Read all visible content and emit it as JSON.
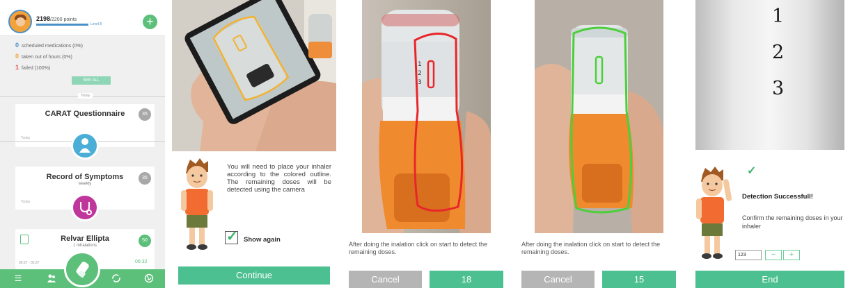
{
  "dashboard": {
    "points": "2198",
    "points_total": "/2200 points",
    "level": "Level 8",
    "progress": 0.9991,
    "legend": [
      {
        "number": "0",
        "text": "scheduled medications (0%)",
        "color": "#4a90c8"
      },
      {
        "number": "0",
        "text": "taken out of hours (0%)",
        "color": "#f2a33a"
      },
      {
        "number": "1",
        "text": "failed (100%)",
        "color": "#e05050"
      }
    ],
    "see_all": "SEE ALL",
    "today": "Today",
    "cards": [
      {
        "title": "CARAT Questionnaire",
        "subtitle": "",
        "badge": "35",
        "today": "Today"
      },
      {
        "title": "Record of Symptoms",
        "subtitle": "weekly",
        "badge": "35",
        "today": "Today"
      },
      {
        "title": "Relvar Ellipta",
        "subtitle": "1 Inhalations",
        "badge": "50",
        "time_left": "00:27 - 02:27",
        "time_right": "05:32"
      }
    ],
    "add_icon": "plus-icon",
    "tabs": [
      "list-icon",
      "people-icon",
      "inhaler-icon",
      "sync-icon",
      "globe-icon"
    ]
  },
  "intro": {
    "instruction": "You will need to place your inhaler according to the colored outline. The remaining doses will be detected using the camera",
    "show_again_label": "Show again",
    "show_again_checked": true,
    "continue_label": "Continue"
  },
  "scan_red": {
    "caption": "After doing the inalation click on start to detect the remaining doses.",
    "cancel_label": "Cancel",
    "count": "18",
    "outline_color": "#e8262a"
  },
  "scan_green": {
    "caption": "After doing the inalation click on start to detect the remaining doses.",
    "cancel_label": "Cancel",
    "count": "15",
    "outline_color": "#4ccf3a"
  },
  "result": {
    "digits": [
      "1",
      "2",
      "3"
    ],
    "success_title": "Detection Successfull!",
    "confirm_text": "Confirm the remaining doses in your inhaler",
    "dose_value": "123",
    "minus_label": "−",
    "plus_label": "+",
    "end_label": "End"
  },
  "colors": {
    "accent": "#4cc090",
    "tabbar": "#5cbf7a",
    "cancel": "#b5b5b5"
  }
}
